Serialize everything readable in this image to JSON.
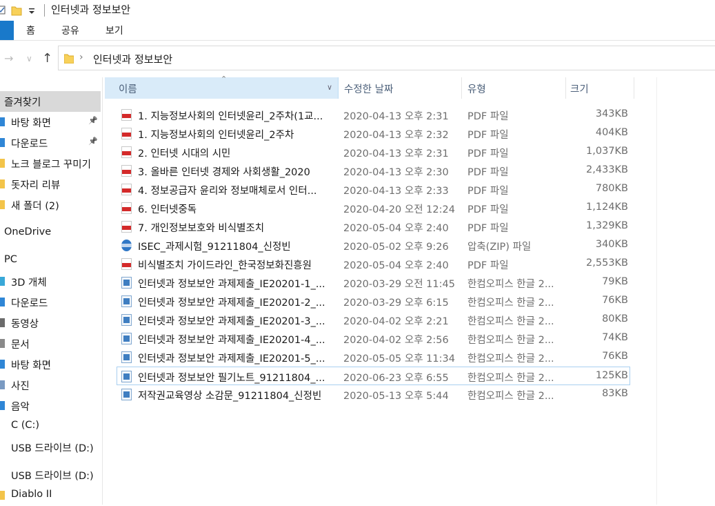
{
  "window": {
    "title": "인터넷과 정보보안"
  },
  "ribbon": {
    "tabs": [
      "홈",
      "공유",
      "보기"
    ]
  },
  "address": {
    "path": "인터넷과 정보보안"
  },
  "columns": {
    "name": "이름",
    "date": "수정한 날짜",
    "type": "유형",
    "size": "크기"
  },
  "sidebar": {
    "items": [
      {
        "label": "즐겨찾기",
        "icon": "star-icon",
        "pinned": false
      },
      {
        "label": "바탕 화면",
        "icon": "desktop-icon",
        "pinned": true
      },
      {
        "label": "다운로드",
        "icon": "download-icon",
        "pinned": true
      },
      {
        "label": "노크 블로그 꾸미기",
        "icon": "folder-icon",
        "pinned": false
      },
      {
        "label": "돗자리 리뷰",
        "icon": "folder-icon",
        "pinned": false
      },
      {
        "label": "새 폴더 (2)",
        "icon": "folder-icon",
        "pinned": false
      },
      {
        "label": "OneDrive",
        "icon": "cloud-icon",
        "pinned": false
      },
      {
        "label": "PC",
        "icon": "pc-icon",
        "pinned": false
      },
      {
        "label": "3D 개체",
        "icon": "cube-icon",
        "pinned": false
      },
      {
        "label": "다운로드",
        "icon": "download-icon",
        "pinned": false
      },
      {
        "label": "동영상",
        "icon": "video-icon",
        "pinned": false
      },
      {
        "label": "문서",
        "icon": "document-icon",
        "pinned": false
      },
      {
        "label": "바탕 화면",
        "icon": "desktop-icon",
        "pinned": false
      },
      {
        "label": "사진",
        "icon": "picture-icon",
        "pinned": false
      },
      {
        "label": "음악",
        "icon": "music-icon",
        "pinned": false
      },
      {
        "label": "C (C:)",
        "icon": "drive-icon",
        "pinned": false
      },
      {
        "label": "USB 드라이브 (D:)",
        "icon": "usb-drive-icon",
        "pinned": false
      },
      {
        "label": "USB 드라이브 (D:)",
        "icon": "usb-drive-icon",
        "pinned": false
      },
      {
        "label": "Diablo II",
        "icon": "folder-icon",
        "pinned": false
      }
    ]
  },
  "files": [
    {
      "name": "1. 지능정보사회의 인터넷윤리_2주차(1교...",
      "date": "2020-04-13 오후 2:31",
      "type": "PDF 파일",
      "size": "343KB",
      "icon": "pdf"
    },
    {
      "name": "1. 지능정보사회의 인터넷윤리_2주차",
      "date": "2020-04-13 오후 2:32",
      "type": "PDF 파일",
      "size": "404KB",
      "icon": "pdf"
    },
    {
      "name": "2. 인터넷 시대의 시민",
      "date": "2020-04-13 오후 2:31",
      "type": "PDF 파일",
      "size": "1,037KB",
      "icon": "pdf"
    },
    {
      "name": "3. 올바른 인터넷 경제와 사회생활_2020",
      "date": "2020-04-13 오후 2:30",
      "type": "PDF 파일",
      "size": "2,433KB",
      "icon": "pdf"
    },
    {
      "name": "4. 정보공급자 윤리와 정보매체로서 인터...",
      "date": "2020-04-13 오후 2:33",
      "type": "PDF 파일",
      "size": "780KB",
      "icon": "pdf"
    },
    {
      "name": "6. 인터넷중독",
      "date": "2020-04-20 오전 12:24",
      "type": "PDF 파일",
      "size": "1,124KB",
      "icon": "pdf"
    },
    {
      "name": "7. 개인정보보호와 비식별조치",
      "date": "2020-05-04 오후 2:40",
      "type": "PDF 파일",
      "size": "1,329KB",
      "icon": "pdf"
    },
    {
      "name": "ISEC_과제시험_91211804_신정빈",
      "date": "2020-05-02 오후 9:26",
      "type": "압축(ZIP) 파일",
      "size": "340KB",
      "icon": "zip"
    },
    {
      "name": "비식별조치 가이드라인_한국정보화진흥원",
      "date": "2020-05-04 오후 2:40",
      "type": "PDF 파일",
      "size": "2,553KB",
      "icon": "pdf"
    },
    {
      "name": "인터넷과 정보보안 과제제출_IE20201-1_...",
      "date": "2020-03-29 오전 11:45",
      "type": "한컴오피스 한글 2...",
      "size": "79KB",
      "icon": "hwp"
    },
    {
      "name": "인터넷과 정보보안 과제제출_IE20201-2_...",
      "date": "2020-03-29 오후 6:15",
      "type": "한컴오피스 한글 2...",
      "size": "76KB",
      "icon": "hwp"
    },
    {
      "name": "인터넷과 정보보안 과제제출_IE20201-3_...",
      "date": "2020-04-02 오후 2:21",
      "type": "한컴오피스 한글 2...",
      "size": "80KB",
      "icon": "hwp"
    },
    {
      "name": "인터넷과 정보보안 과제제출_IE20201-4_...",
      "date": "2020-04-02 오후 2:56",
      "type": "한컴오피스 한글 2...",
      "size": "74KB",
      "icon": "hwp"
    },
    {
      "name": "인터넷과 정보보안 과제제출_IE20201-5_...",
      "date": "2020-05-05 오후 11:34",
      "type": "한컴오피스 한글 2...",
      "size": "76KB",
      "icon": "hwp"
    },
    {
      "name": "인터넷과 정보보안 필기노트_91211804_...",
      "date": "2020-06-23 오후 6:55",
      "type": "한컴오피스 한글 2...",
      "size": "125KB",
      "icon": "hwp",
      "selected": true
    },
    {
      "name": "저작권교육영상 소감문_91211804_신정빈",
      "date": "2020-05-13 오후 5:44",
      "type": "한컴오피스 한글 2...",
      "size": "83KB",
      "icon": "hwp"
    }
  ]
}
